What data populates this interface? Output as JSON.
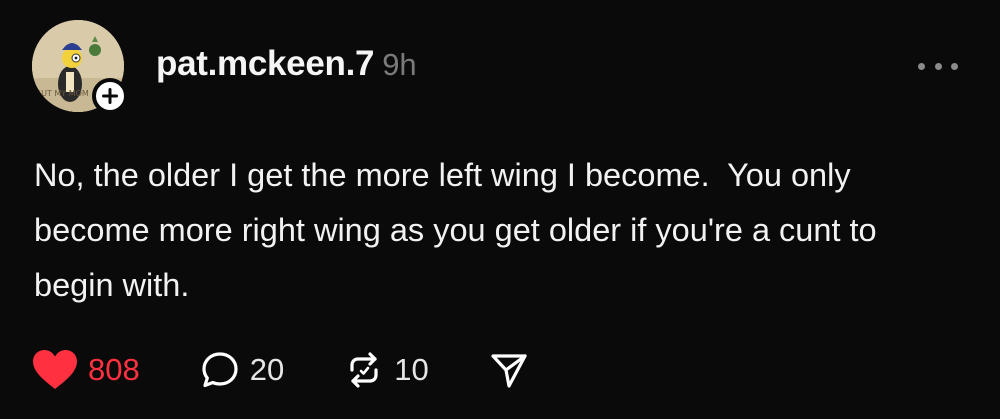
{
  "post": {
    "username": "pat.mckeen.7",
    "timestamp": "9h",
    "text": "No, the older I get the more left wing I become.  You only become more right wing as you get older if you're a cunt to begin with.",
    "avatar_caption": "SUT MY MOM"
  },
  "actions": {
    "likes": "808",
    "comments": "20",
    "reposts": "10"
  },
  "icons": {
    "like": "heart-filled-icon",
    "comment": "speech-bubble-icon",
    "repost": "repost-arrows-icon",
    "share": "paper-plane-icon",
    "more": "ellipsis-icon",
    "follow": "plus-icon"
  },
  "colors": {
    "background": "#0a0a0a",
    "like_accent": "#ff3040",
    "text_primary": "#f2f2f2",
    "text_muted": "#7a7a7a"
  }
}
